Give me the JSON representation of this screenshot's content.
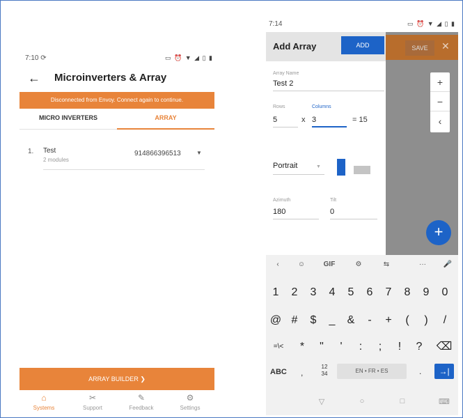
{
  "left": {
    "status_time": "7:10 ⟳",
    "status_icons": "▭ ⏰ ▼ ◢ ▯ ▮",
    "back_icon": "←",
    "title": "Microinverters & Array",
    "banner": "Disconnected from Envoy. Connect again to continue.",
    "tabs": [
      {
        "label": "MICRO INVERTERS"
      },
      {
        "label": "ARRAY"
      }
    ],
    "arrays": [
      {
        "index": "1.",
        "name": "Test",
        "modules": "2 modules",
        "serial": "914866396513"
      }
    ],
    "builder_label": "ARRAY BUILDER  ❯",
    "nav": [
      {
        "label": "Systems",
        "icon": "home-icon",
        "glyph": "⌂"
      },
      {
        "label": "Support",
        "icon": "wrench-icon",
        "glyph": "🔧"
      },
      {
        "label": "Feedback",
        "icon": "feedback-icon",
        "glyph": "✎"
      },
      {
        "label": "Settings",
        "icon": "gear-icon",
        "glyph": "⚙"
      }
    ],
    "accent": "#e8843a"
  },
  "right": {
    "status_time": "7:14",
    "status_icons": "▭ ⏰ ▼ ◢ ▯ ▮",
    "save_label": "SAVE",
    "close_icon": "✕",
    "zoom_in": "+",
    "zoom_out": "−",
    "collapse": "‹",
    "fab": "+",
    "dialog": {
      "title": "Add Array",
      "add_label": "ADD",
      "array_name_label": "Array Name",
      "array_name_value": "Test 2",
      "rows_label": "Rows",
      "rows_value": "5",
      "times": "x",
      "columns_label": "Columns",
      "columns_value": "3",
      "equals": "= 15",
      "orientation_value": "Portrait",
      "azimuth_label": "Azimuth",
      "azimuth_value": "180",
      "tilt_label": "Tilt",
      "tilt_value": "0"
    },
    "keyboard": {
      "tools": [
        "‹",
        "☺",
        "GIF",
        "⚙",
        "⇆",
        "···",
        "🎤"
      ],
      "row1": [
        "1",
        "2",
        "3",
        "4",
        "5",
        "6",
        "7",
        "8",
        "9",
        "0"
      ],
      "row2": [
        "@",
        "#",
        "$",
        "_",
        "&",
        "-",
        "+",
        "(",
        ")",
        "/"
      ],
      "row3": [
        "=\\<",
        "*",
        "\"",
        "'",
        ":",
        ";",
        "!",
        "?",
        "⌫"
      ],
      "abc": "ABC",
      "comma": ",",
      "frac_top": "12",
      "frac_bottom": "34",
      "space": "EN • FR • ES",
      "dot": ".",
      "enter": "→|",
      "sysnav": [
        "▽",
        "○",
        "□",
        "⌨"
      ]
    },
    "accent": "#1d63c7"
  }
}
